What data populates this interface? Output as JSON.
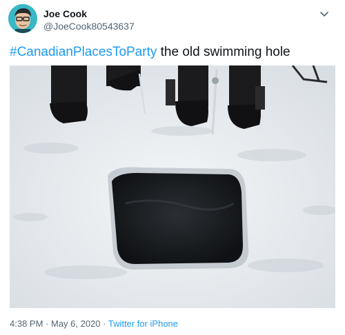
{
  "author": {
    "display_name": "Joe Cook",
    "handle": "@JoeCook80543637",
    "avatar_icon": "avatar-face-icon"
  },
  "menu_icon": "chevron-down-icon",
  "tweet": {
    "hashtag": "#CanadianPlacesToParty",
    "text": " the old swimming hole"
  },
  "media": {
    "alt": "Square hole cut in snowy ice with people's boots nearby"
  },
  "meta": {
    "time": "4:38 PM",
    "separator": " · ",
    "date": "May 6, 2020",
    "source": "Twitter for iPhone"
  },
  "colors": {
    "link": "#1d9bf0",
    "secondary_text": "#536471",
    "primary_text": "#0f1419"
  }
}
